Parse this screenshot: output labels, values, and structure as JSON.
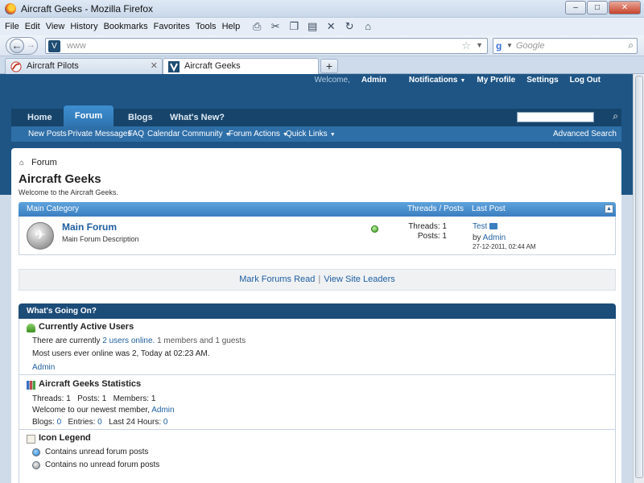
{
  "window": {
    "title": "Aircraft Geeks - Mozilla Firefox"
  },
  "menubar": {
    "items": [
      "File",
      "Edit",
      "View",
      "History",
      "Bookmarks",
      "Favorites",
      "Tools",
      "Help"
    ]
  },
  "urlbar": {
    "url": "www"
  },
  "searchbar": {
    "placeholder": "Google"
  },
  "tabs": [
    {
      "label": "Aircraft Pilots",
      "active": false
    },
    {
      "label": "Aircraft Geeks",
      "active": true
    }
  ],
  "site": {
    "toplinks": {
      "welcome": "Welcome,",
      "user": "Admin",
      "notifications": "Notifications",
      "profile": "My Profile",
      "settings": "Settings",
      "logout": "Log Out"
    },
    "navtabs": [
      "Home",
      "Forum",
      "Blogs",
      "What's New?"
    ],
    "subnav": [
      "New Posts",
      "Private Messages",
      "FAQ",
      "Calendar",
      "Community",
      "Forum Actions",
      "Quick Links"
    ],
    "advanced_search": "Advanced Search"
  },
  "page": {
    "breadcrumb": "Forum",
    "title": "Aircraft Geeks",
    "description": "Welcome to the Aircraft Geeks."
  },
  "category": {
    "name": "Main Category",
    "col_threads_posts": "Threads / Posts",
    "col_last_post": "Last Post"
  },
  "forum": {
    "name": "Main Forum",
    "description": "Main Forum Description",
    "threads": "Threads: 1",
    "posts": "Posts: 1",
    "last_post_title": "Test",
    "last_post_by": "by",
    "last_post_user": "Admin",
    "last_post_date": "27-12-2011, 02:44 AM"
  },
  "actions": {
    "mark_read": "Mark Forums Read",
    "separator": "|",
    "site_leaders": "View Site Leaders"
  },
  "wgo": {
    "title": "What's Going On?",
    "active_users": {
      "heading": "Currently Active Users",
      "line1_prefix": "There are currently",
      "line1_link": "2 users online.",
      "line1_suffix": "1 members and 1 guests",
      "line2": "Most users ever online was 2, Today at 02:23 AM.",
      "user": "Admin"
    },
    "stats": {
      "heading": "Aircraft Geeks Statistics",
      "line1": "Threads: 1   Posts: 1   Members: 1",
      "line2_prefix": "Welcome to our newest member,",
      "line2_user": "Admin",
      "blogs_label": "Blogs:",
      "blogs_value": "0",
      "entries_label": "Entries:",
      "entries_value": "0",
      "last24_label": "Last 24 Hours:",
      "last24_value": "0"
    },
    "legend": {
      "heading": "Icon Legend",
      "item1": "Contains unread forum posts",
      "item2": "Contains no unread forum posts"
    }
  }
}
